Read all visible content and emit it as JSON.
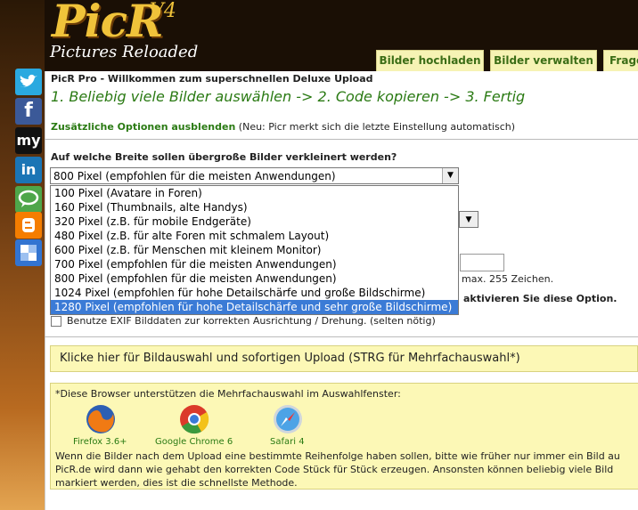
{
  "logo": {
    "brand": "PicR",
    "version": "V4",
    "tagline": "Pictures Reloaded"
  },
  "nav_tabs": [
    {
      "label": "Bilder hochladen"
    },
    {
      "label": "Bilder verwalten"
    },
    {
      "label": "Frage"
    }
  ],
  "social_icons": [
    "twitter-icon",
    "facebook-icon",
    "myspace-icon",
    "linkedin-icon",
    "chat-icon",
    "blogger-icon",
    "delicious-icon"
  ],
  "main": {
    "heading": "PicR Pro - Willkommen zum superschnellen Deluxe Upload",
    "steps": "1. Beliebig viele Bilder auswählen -> 2. Code kopieren -> 3. Fertig",
    "options_link": "Zusätzliche Optionen ausblenden",
    "options_note": "(Neu: Picr merkt sich die letzte Einstellung automatisch)",
    "width_question": "Auf welche Breite sollen übergroße Bilder verkleinert werden?",
    "width_select": {
      "value": "800 Pixel (empfohlen für die meisten Anwendungen)",
      "options": [
        "100 Pixel (Avatare in Foren)",
        "160 Pixel (Thumbnails, alte Handys)",
        "320 Pixel (z.B. für mobile Endgeräte)",
        "480 Pixel (z.B. für alte Foren mit schmalem Layout)",
        "600 Pixel (z.B. für Menschen mit kleinem Monitor)",
        "700 Pixel (empfohlen für die meisten Anwendungen)",
        "800 Pixel (empfohlen für die meisten Anwendungen)",
        "1024 Pixel (empfohlen für hohe Detailschärfe und große Bildschirme)",
        "1280 Pixel (empfohlen für hohe Detailschärfe und sehr große Bildschirme)"
      ],
      "highlighted": "1280 Pixel (empfohlen für hohe Detailschärfe und sehr große Bildschirme)"
    },
    "max_chars": "max. 255 Zeichen.",
    "activate_option": "aktivieren Sie diese Option.",
    "exif_label": "Benutze EXIF Bilddaten zur korrekten Ausrichtung / Drehung. (selten nötig)",
    "upload_button": "Klicke hier für Bildauswahl und sofortigen Upload (STRG für Mehrfachauswahl*)",
    "browsers_note": "*Diese Browser unterstützen die Mehrfachauswahl im Auswahlfenster:",
    "browsers": [
      {
        "label": "Firefox 3.6+",
        "icon": "firefox-icon"
      },
      {
        "label": "Google Chrome 6",
        "icon": "chrome-icon"
      },
      {
        "label": "Safari 4",
        "icon": "safari-icon"
      }
    ],
    "info_lines": [
      "Wenn die Bilder nach dem Upload eine bestimmte Reihenfolge haben sollen, bitte wie früher nur immer ein Bild au",
      "PicR.de wird dann wie gehabt den korrekten Code Stück für Stück erzeugen. Ansonsten können beliebig viele Bild",
      "markiert werden, dies ist die schnellste Methode."
    ]
  },
  "colors": {
    "accent_green": "#2a7a13",
    "tab_bg": "#f6f3b4",
    "highlight_blue": "#3b7bd6"
  }
}
